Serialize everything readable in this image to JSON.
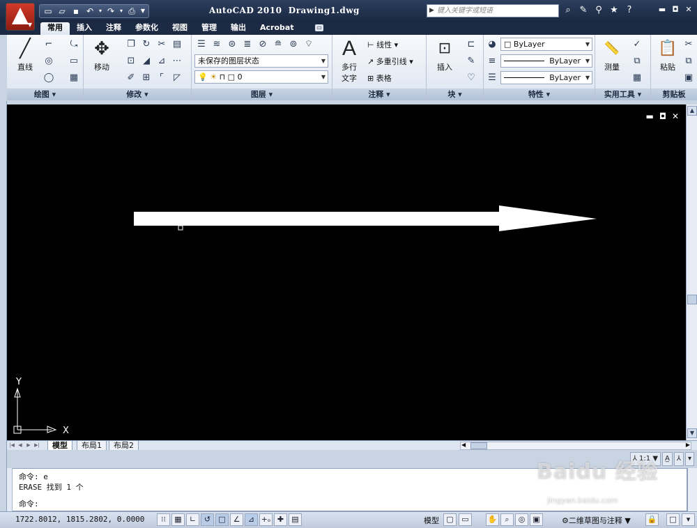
{
  "titlebar": {
    "title": "AutoCAD 2010  Drawing1.dwg",
    "search_placeholder": "键入关键字或短语",
    "quick_access": [
      "new-icon",
      "open-icon",
      "save-icon",
      "undo-icon",
      "redo-icon",
      "print-icon"
    ]
  },
  "ribbon_tabs": [
    {
      "label": "常用",
      "active": true
    },
    {
      "label": "插入",
      "active": false
    },
    {
      "label": "注释",
      "active": false
    },
    {
      "label": "参数化",
      "active": false
    },
    {
      "label": "视图",
      "active": false
    },
    {
      "label": "管理",
      "active": false
    },
    {
      "label": "输出",
      "active": false
    },
    {
      "label": "Acrobat",
      "active": false
    }
  ],
  "panels": {
    "draw": {
      "title": "绘图",
      "line_label": "直线"
    },
    "modify": {
      "title": "修改",
      "move_label": "移动"
    },
    "layers": {
      "title": "图层",
      "layer_state": "未保存的图层状态",
      "current_layer": "0"
    },
    "annotation": {
      "title": "注释",
      "mtext_label_1": "多行",
      "mtext_label_2": "文字",
      "linear_label": "线性",
      "mleader_label": "多重引线",
      "table_label": "表格"
    },
    "block": {
      "title": "块",
      "insert_label": "插入"
    },
    "properties": {
      "title": "特性",
      "color": "ByLayer",
      "linetype": "ByLayer",
      "lineweight": "ByLayer"
    },
    "utilities": {
      "title": "实用工具",
      "measure_label": "测量"
    },
    "clipboard": {
      "title": "剪贴板",
      "paste_label": "粘贴"
    }
  },
  "drawing": {
    "background": "#000000",
    "arrow_color": "#ffffff",
    "ucs_x": "X",
    "ucs_y": "Y"
  },
  "layout_tabs": [
    "模型",
    "布局1",
    "布局2"
  ],
  "annotation_scale": "1:1",
  "command_line": {
    "history": [
      "命令: e",
      "ERASE 找到 1 个"
    ],
    "prompt": "命令:"
  },
  "statusbar": {
    "coordinates": "1722.8012, 1815.2802, 0.0000",
    "model_label": "模型",
    "workspace": "二维草图与注释"
  },
  "watermark": {
    "text": "Baidu 经验",
    "sub": "jingyan.baidu.com"
  }
}
